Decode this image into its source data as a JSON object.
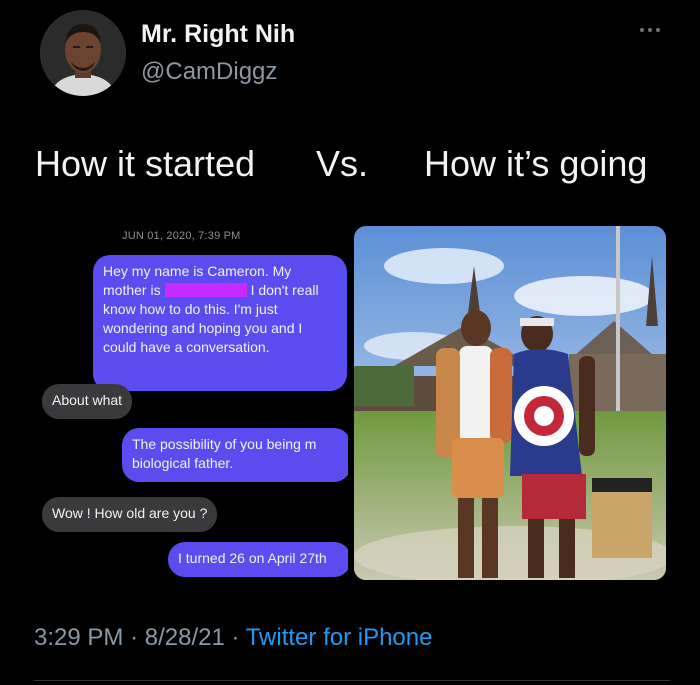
{
  "tweet": {
    "display_name": "Mr. Right Nih",
    "handle": "@CamDiggz",
    "text_left": "How it started",
    "text_mid": "Vs.",
    "text_right": "How it’s going",
    "time": "3:29 PM",
    "separator": "·",
    "date": "8/28/21",
    "source": "Twitter for iPhone",
    "more_icon": "more-horizontal-icon"
  },
  "conversation": {
    "timestamp": "JUN 01, 2020, 7:39 PM",
    "messages": [
      {
        "direction": "sent",
        "lines": [
          "Hey my name is Cameron. My",
          "mother is",
          "I don't reall",
          "know how to do this. I'm just",
          "wondering and hoping you and I",
          "could have a conversation."
        ]
      },
      {
        "direction": "received",
        "text": "About what"
      },
      {
        "direction": "sent",
        "lines": [
          "The possibility of you being m",
          "biological father."
        ]
      },
      {
        "direction": "received",
        "text": "Wow ! How old are you ?"
      },
      {
        "direction": "sent",
        "text": "I turned 26 on April 27th"
      }
    ]
  },
  "colors": {
    "background": "#000000",
    "sent_bubble": "#5b4cf0",
    "received_bubble": "#3a3a3c",
    "redaction": "#c62bff",
    "link": "#1d9bf0",
    "muted": "#8b98a5"
  }
}
